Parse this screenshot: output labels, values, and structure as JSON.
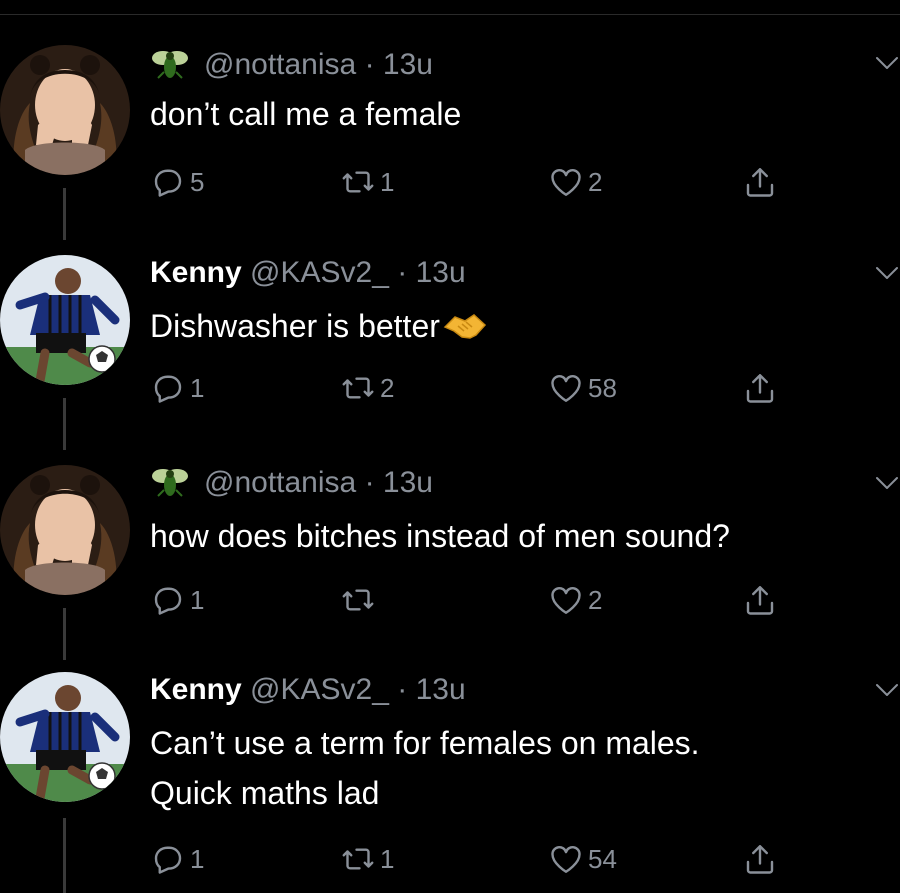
{
  "tweets": [
    {
      "name": "",
      "handle": "@nottanisa",
      "separator": "·",
      "time": "13u",
      "lines": [
        "don’t call me a female"
      ],
      "replies": "5",
      "retweets": "1",
      "likes": "2",
      "badge_icon": "fly-emoji-icon"
    },
    {
      "name": "Kenny",
      "handle": "@KASv2_",
      "separator": "·",
      "time": "13u",
      "lines": [
        "Dishwasher is better"
      ],
      "replies": "1",
      "retweets": "2",
      "likes": "58",
      "inline_emoji": "handshake-emoji-icon"
    },
    {
      "name": "",
      "handle": "@nottanisa",
      "separator": "·",
      "time": "13u",
      "lines": [
        "how does bitches instead of men sound?"
      ],
      "replies": "1",
      "retweets": "",
      "likes": "2",
      "badge_icon": "fly-emoji-icon"
    },
    {
      "name": "Kenny",
      "handle": "@KASv2_",
      "separator": "·",
      "time": "13u",
      "lines": [
        "Can’t use a term for females on males.",
        "Quick maths lad"
      ],
      "replies": "1",
      "retweets": "1",
      "likes": "54"
    }
  ],
  "colors": {
    "background": "#000000",
    "text": "#ffffff",
    "secondary": "#8a9099",
    "thread_line": "#3a3a3a"
  },
  "icons": [
    "reply-icon",
    "retweet-icon",
    "like-icon",
    "share-icon",
    "chevron-down-icon"
  ]
}
